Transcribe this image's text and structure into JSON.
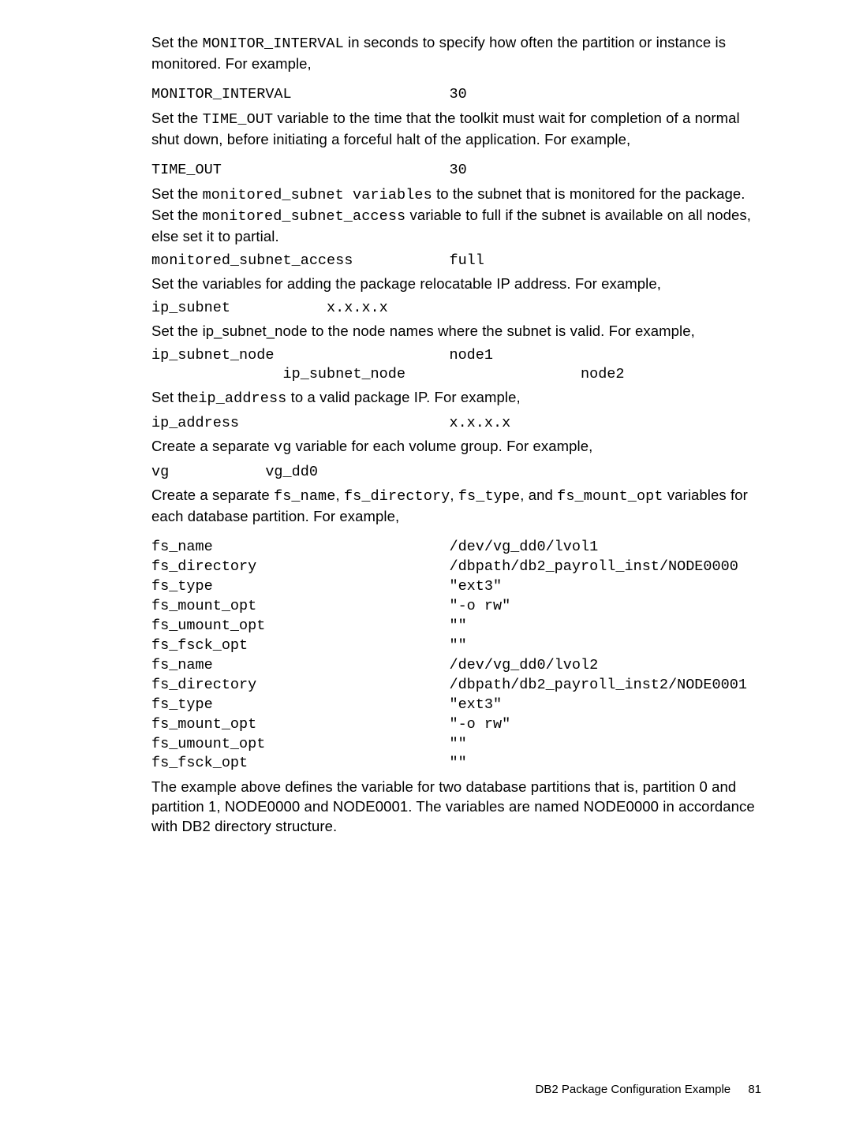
{
  "p1": {
    "a": "Set the ",
    "b": "MONITOR_INTERVAL",
    "c": " in seconds to specify how often the partition or instance is monitored. For example,"
  },
  "c1": "MONITOR_INTERVAL                  30",
  "p2": {
    "a": "Set the ",
    "b": "TIME_OUT",
    "c": " variable to the time that the toolkit must wait for completion of a normal shut down, before initiating a forceful halt of the application. For example,"
  },
  "c2": "TIME_OUT                          30",
  "p3": {
    "a": "Set the ",
    "b": "monitored_subnet variables",
    "c": " to the subnet that is monitored for the package. Set the ",
    "d": "monitored_subnet_access",
    "e": " variable to full if the subnet is available on all nodes, else set it to partial."
  },
  "c3": "monitored_subnet_access           full",
  "p4": "Set the variables for adding the package relocatable IP address. For example,",
  "c4": "ip_subnet           x.x.x.x",
  "p5": "Set the ip_subnet_node to the node names where the subnet is valid. For example,",
  "c5": "ip_subnet_node                    node1\n               ip_subnet_node                    node2",
  "p6": {
    "a": "Set the",
    "b": "ip_address",
    "c": " to a valid package IP. For example,"
  },
  "c6": "ip_address                        x.x.x.x",
  "p7": {
    "a": "Create a separate ",
    "b": "vg",
    "c": " variable for each volume group. For example,"
  },
  "c7": "vg           vg_dd0",
  "p8": {
    "a": "Create a separate ",
    "b": "fs_name",
    "c": ", ",
    "d": "fs_directory",
    "e": ", ",
    "f": "fs_type",
    "g": ", and ",
    "h": "fs_mount_opt",
    "i": " variables for each database partition. For example,"
  },
  "c8": "fs_name                           /dev/vg_dd0/lvol1\nfs_directory                      /dbpath/db2_payroll_inst/NODE0000\nfs_type                           \"ext3\"\nfs_mount_opt                      \"-o rw\"\nfs_umount_opt                     \"\"\nfs_fsck_opt                       \"\"\nfs_name                           /dev/vg_dd0/lvol2\nfs_directory                      /dbpath/db2_payroll_inst2/NODE0001\nfs_type                           \"ext3\"\nfs_mount_opt                      \"-o rw\"\nfs_umount_opt                     \"\"\nfs_fsck_opt                       \"\"",
  "p9": "The example above defines the variable for two database partitions that is, partition 0 and partition 1, NODE0000 and NODE0001. The variables are named NODE0000 in accordance with DB2 directory structure.",
  "footer": {
    "title": "DB2 Package Configuration Example",
    "page": "81"
  }
}
